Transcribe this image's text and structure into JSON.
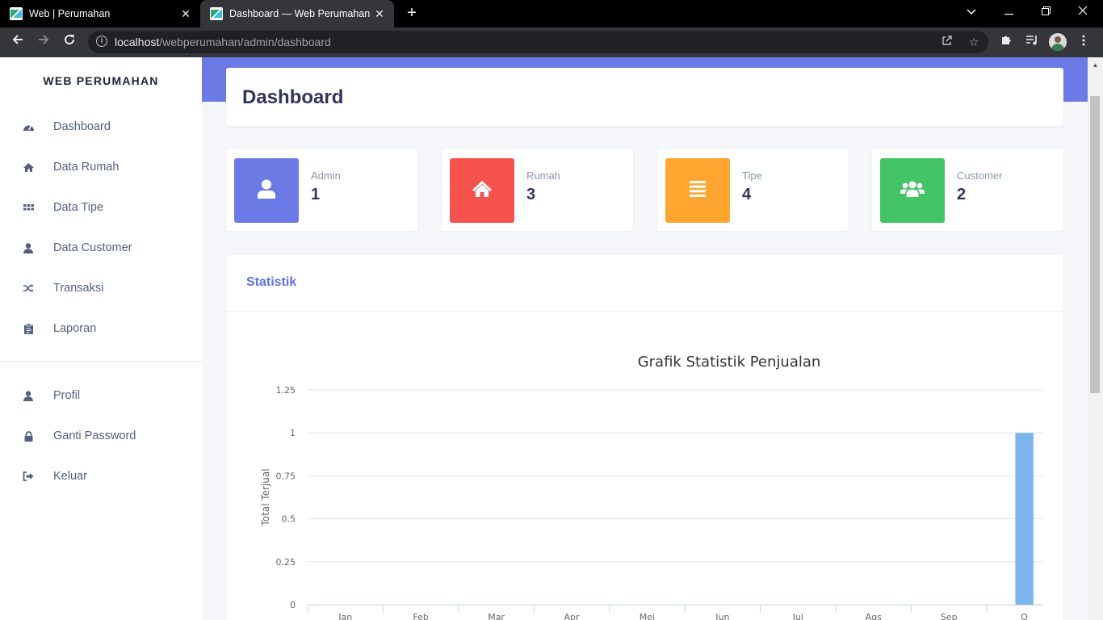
{
  "browser": {
    "tabs": [
      {
        "title": "Web | Perumahan",
        "active": false
      },
      {
        "title": "Dashboard — Web Perumahan",
        "active": true
      }
    ],
    "url_host": "localhost",
    "url_path": "/webperumahan/admin/dashboard",
    "icons": {
      "back": "arrow-left-icon",
      "forward": "arrow-right-icon",
      "reload": "reload-icon",
      "share": "share-icon",
      "bookmark": "star-icon",
      "extensions": "puzzle-icon",
      "media": "media-queue-icon",
      "menu": "kebab-menu-icon"
    }
  },
  "sidebar": {
    "brand": "WEB PERUMAHAN",
    "menu": [
      {
        "label": "Dashboard",
        "icon": "tachometer-icon"
      },
      {
        "label": "Data Rumah",
        "icon": "home-icon"
      },
      {
        "label": "Data Tipe",
        "icon": "grid-icon"
      },
      {
        "label": "Data Customer",
        "icon": "user-icon"
      },
      {
        "label": "Transaksi",
        "icon": "shuffle-icon"
      },
      {
        "label": "Laporan",
        "icon": "clipboard-icon"
      }
    ],
    "account": [
      {
        "label": "Profil",
        "icon": "user-icon"
      },
      {
        "label": "Ganti Password",
        "icon": "lock-icon"
      },
      {
        "label": "Keluar",
        "icon": "sign-out-icon"
      }
    ]
  },
  "header": {
    "title": "Dashboard"
  },
  "stats": [
    {
      "label": "Admin",
      "value": "1",
      "color": "#6c7ae6",
      "icon": "user-icon"
    },
    {
      "label": "Rumah",
      "value": "3",
      "color": "#f5524e",
      "icon": "home-icon"
    },
    {
      "label": "Tipe",
      "value": "4",
      "color": "#ffa630",
      "icon": "list-icon"
    },
    {
      "label": "Customer",
      "value": "2",
      "color": "#43c466",
      "icon": "users-icon"
    }
  ],
  "statistik": {
    "heading": "Statistik"
  },
  "chart_data": {
    "type": "bar",
    "title": "Grafik Statistik Penjualan",
    "ylabel": "Total Terjual",
    "xlabel": "",
    "categories": [
      "Jan",
      "Feb",
      "Mar",
      "Apr",
      "Mei",
      "Jun",
      "Jul",
      "Ags",
      "Sep",
      "O"
    ],
    "values": [
      0,
      0,
      0,
      0,
      0,
      0,
      0,
      0,
      0,
      1
    ],
    "ylim": [
      0,
      1.25
    ],
    "yticks": [
      "0",
      "0.25",
      "0.5",
      "0.75",
      "1",
      "1.25"
    ],
    "bar_color": "#7cb5ec",
    "grid": true
  }
}
